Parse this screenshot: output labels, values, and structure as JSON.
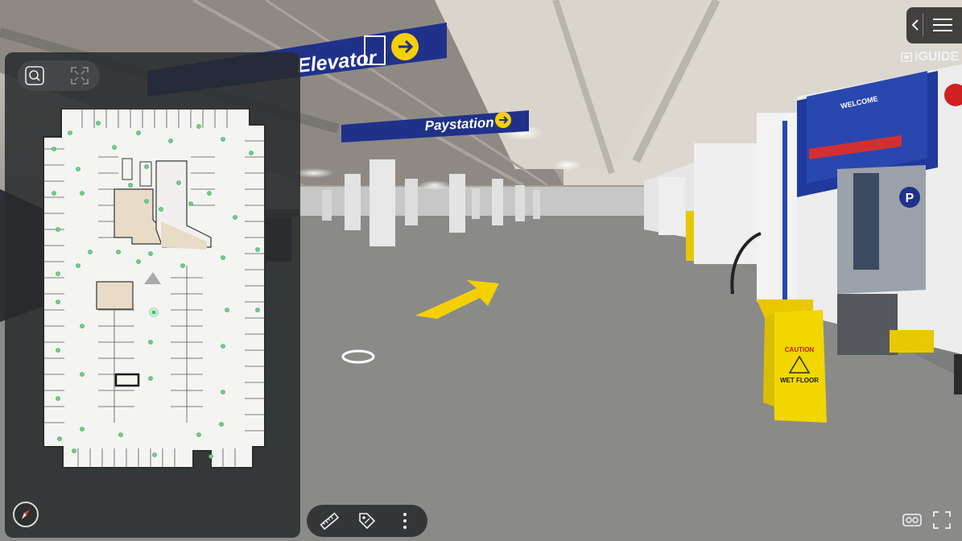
{
  "scene": {
    "signs": {
      "elevator": "Elevator",
      "paystation": "Paystation",
      "welcome": "WELCOME",
      "caution": "CAUTION",
      "wet_floor": "WET FLOOR",
      "parking_letter": "P"
    },
    "colors": {
      "sign_blue": "#20318a",
      "arrow_yellow": "#f4d000",
      "accent_green": "#3ec46d"
    }
  },
  "header": {
    "menu_icon": "hamburger-icon",
    "collapse_icon": "chevron-left-icon",
    "brand": "iGUIDE"
  },
  "floorplan_panel": {
    "tools": {
      "search_icon": "zoom-search-icon",
      "fullscreen_icon": "expand-icon"
    },
    "compass_icon": "compass-icon"
  },
  "bottom_toolbar": {
    "measure_icon": "ruler-icon",
    "tag_icon": "tag-icon",
    "more_icon": "more-vertical-icon"
  },
  "view_controls": {
    "vr_icon": "vr-headset-icon",
    "fullscreen_icon": "fullscreen-icon"
  }
}
